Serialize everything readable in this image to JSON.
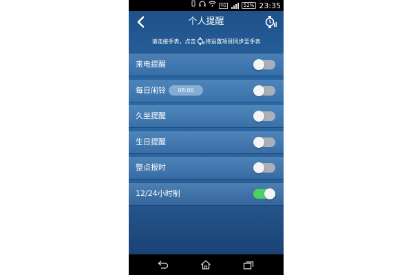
{
  "status_bar": {
    "network_label": "4G",
    "battery": "52%",
    "time": "23:35"
  },
  "header": {
    "title": "个人提醒",
    "back_icon": "chevron-left-icon",
    "sync_icon": "watch-sync-icon"
  },
  "hint": {
    "prefix": "请连接手表，点击",
    "suffix": "将设置项目同步至手表"
  },
  "settings": [
    {
      "label": "来电提醒",
      "enabled": false
    },
    {
      "label": "每日闹铃",
      "time": "08:00",
      "enabled": false
    },
    {
      "label": "久坐提醒",
      "enabled": false
    },
    {
      "label": "生日提醒",
      "enabled": false
    },
    {
      "label": "整点报时",
      "enabled": false
    },
    {
      "label": "12/24小时制",
      "enabled": true
    }
  ],
  "colors": {
    "toggle_on": "#4cd35f",
    "toggle_off": "#a9b0b8",
    "background_top": "#1d4d86",
    "background_bottom": "#163a6a"
  }
}
